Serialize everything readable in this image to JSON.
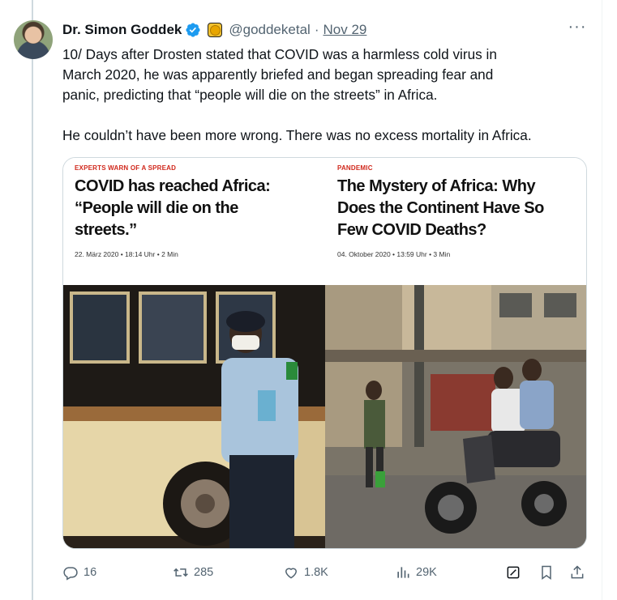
{
  "tweet": {
    "author_name": "Dr. Simon Goddek",
    "handle": "@goddeketal",
    "separator": "·",
    "date": "Nov 29",
    "more_label": "···",
    "text_lines": [
      "10/ Days after Drosten stated that COVID was a harmless cold virus in",
      "March 2020, he was apparently briefed and began spreading fear and",
      "panic, predicting that “people will die on the streets” in Africa.",
      "He couldn’t have been more wrong. There was no excess mortality in Africa."
    ]
  },
  "media": {
    "left": {
      "kicker": "EXPERTS WARN OF A SPREAD",
      "headline_lines": [
        "COVID has reached Africa:",
        "“People will die on the",
        "streets.”"
      ],
      "meta": "22. März 2020  •  18:14 Uhr  •  2 Min"
    },
    "right": {
      "kicker": "PANDEMIC",
      "headline_lines": [
        "The Mystery of Africa: Why",
        "Does the Continent Have So",
        "Few COVID Deaths?"
      ],
      "meta": "04. Oktober 2020  •  13:59 Uhr  •  3 Min"
    }
  },
  "actions": {
    "replies": "16",
    "retweets": "285",
    "likes": "1.8K",
    "views": "29K"
  },
  "colors": {
    "verified_blue": "#1d9bf0",
    "kicker_red": "#d0281c",
    "muted_text": "#536471"
  }
}
